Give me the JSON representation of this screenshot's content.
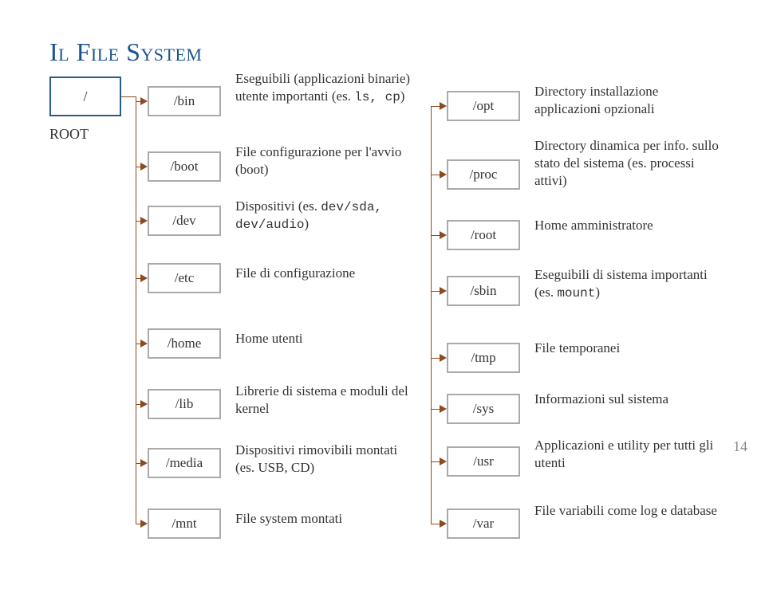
{
  "title": "Il File System",
  "page_number": "14",
  "root": {
    "path": "/",
    "label": "ROOT"
  },
  "left_column": [
    {
      "path": "/bin",
      "desc": "Eseguibili (applicazioni binarie) utente importanti (es. ",
      "code": "ls, cp",
      "desc_after": ")"
    },
    {
      "path": "/boot",
      "desc": "File configurazione per l'avvio (boot)"
    },
    {
      "path": "/dev",
      "desc": "Dispositivi (es. ",
      "code": "dev/sda, dev/audio",
      "desc_after": ")"
    },
    {
      "path": "/etc",
      "desc": "File di configurazione"
    },
    {
      "path": "/home",
      "desc": "Home utenti"
    },
    {
      "path": "/lib",
      "desc": "Librerie di sistema e moduli del kernel"
    },
    {
      "path": "/media",
      "desc": "Dispositivi rimovibili montati (es. USB, CD)"
    },
    {
      "path": "/mnt",
      "desc": "File system montati"
    }
  ],
  "right_column": [
    {
      "path": "/opt",
      "desc": "Directory installazione applicazioni opzionali"
    },
    {
      "path": "/proc",
      "desc": "Directory dinamica per info. sullo stato del sistema (es. processi attivi)"
    },
    {
      "path": "/root",
      "desc": "Home amministratore"
    },
    {
      "path": "/sbin",
      "desc": "Eseguibili di sistema importanti (es. ",
      "code": "mount",
      "desc_after": ")"
    },
    {
      "path": "/tmp",
      "desc": "File temporanei"
    },
    {
      "path": "/sys",
      "desc": "Informazioni sul sistema"
    },
    {
      "path": "/usr",
      "desc": "Applicazioni e utility per tutti gli utenti"
    },
    {
      "path": "/var",
      "desc": "File variabili come log e database"
    }
  ]
}
